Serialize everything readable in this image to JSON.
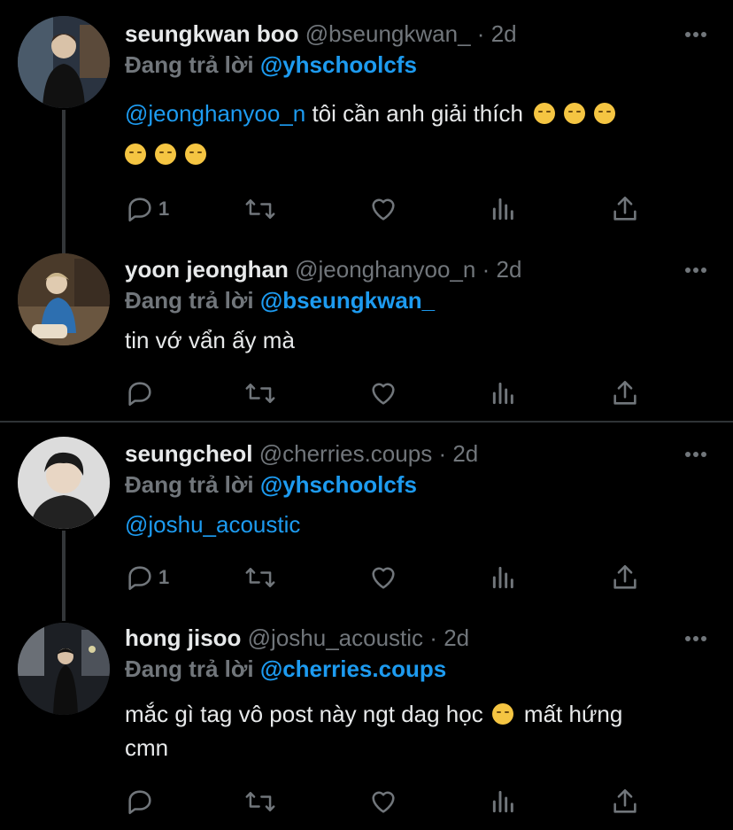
{
  "tweets": [
    {
      "display_name": "seungkwan boo",
      "handle": "@bseungkwan_",
      "time": "2d",
      "reply_prefix": "Đang trả lời",
      "reply_to": "@yhschoolcfs",
      "mention": "@jeonghanyoo_n",
      "text": " tôi cần anh giải thích",
      "emoji_count_line1": 3,
      "emoji_count_line2": 3,
      "reply_count": "1",
      "avatar_icon": "avatar-photo"
    },
    {
      "display_name": "yoon jeonghan",
      "handle": "@jeonghanyoo_n",
      "time": "2d",
      "reply_prefix": "Đang trả lời",
      "reply_to": "@bseungkwan_",
      "text": "tin vớ vẩn ấy mà",
      "reply_count": "",
      "avatar_icon": "avatar-photo"
    },
    {
      "display_name": "seungcheol",
      "handle": "@cherries.coups",
      "time": "2d",
      "reply_prefix": "Đang trả lời",
      "reply_to": "@yhschoolcfs",
      "mention": "@joshu_acoustic",
      "reply_count": "1",
      "avatar_icon": "avatar-photo"
    },
    {
      "display_name": "hong jisoo",
      "handle": "@joshu_acoustic",
      "time": "2d",
      "reply_prefix": "Đang trả lời",
      "reply_to": "@cherries.coups",
      "text_part1": "mắc gì tag vô post này ngt dag học",
      "text_part2": " mất hứng",
      "text_line2": "cmn",
      "reply_count": "",
      "avatar_icon": "avatar-photo"
    }
  ],
  "separator": "·",
  "colors": {
    "background": "#000000",
    "text": "#e7e9ea",
    "muted": "#71767b",
    "accent": "#1d9bf0",
    "line": "#333639"
  },
  "icons": [
    "reply-icon",
    "retweet-icon",
    "like-icon",
    "analytics-icon",
    "share-icon",
    "more-icon"
  ]
}
